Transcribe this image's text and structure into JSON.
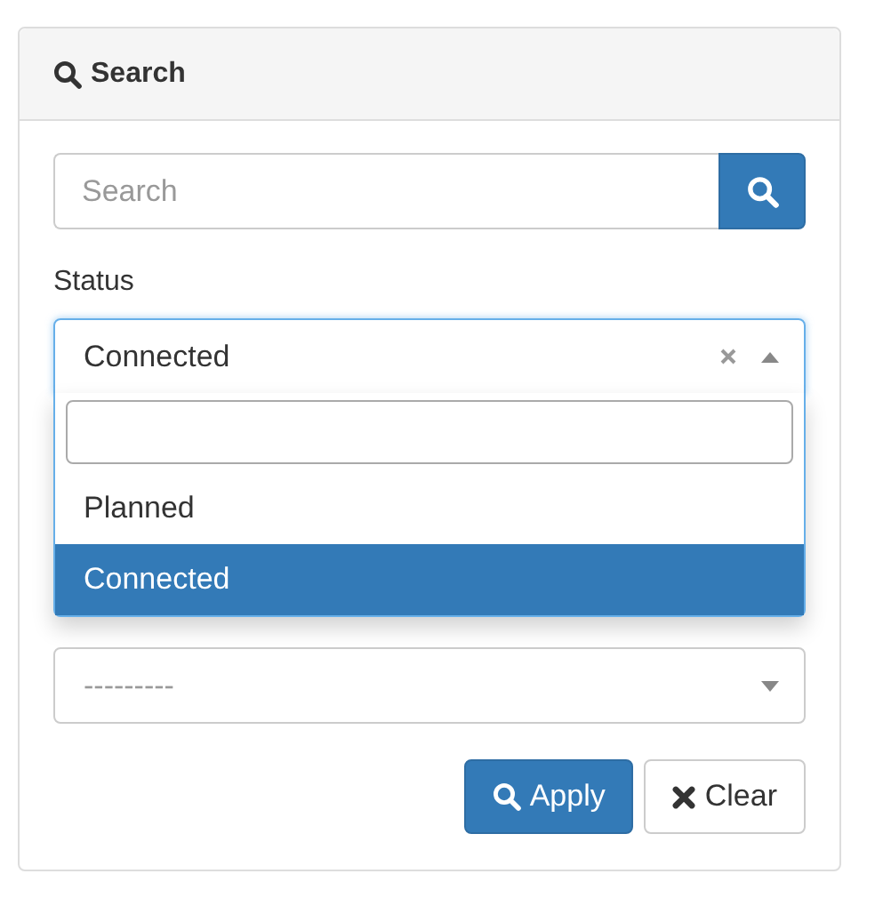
{
  "panel": {
    "title": "Search"
  },
  "search": {
    "placeholder": "Search"
  },
  "status": {
    "label": "Status",
    "value": "Connected",
    "expanded": true,
    "options": [
      {
        "label": "Planned",
        "selected": false
      },
      {
        "label": "Connected",
        "selected": true
      }
    ]
  },
  "color": {
    "value": "---------"
  },
  "buttons": [
    {
      "label": "Apply",
      "kind": "primary"
    },
    {
      "label": "Clear",
      "kind": "default"
    }
  ]
}
